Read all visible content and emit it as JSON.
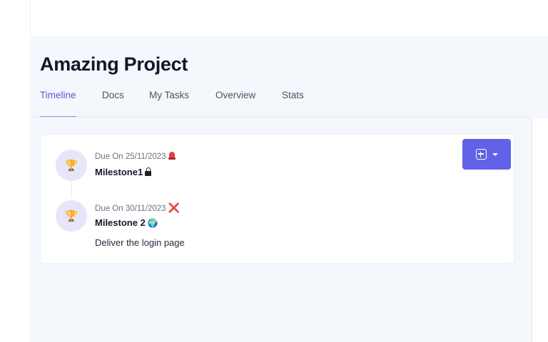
{
  "project": {
    "title": "Amazing Project"
  },
  "tabs": [
    {
      "label": "Timeline",
      "active": true
    },
    {
      "label": "Docs",
      "active": false
    },
    {
      "label": "My Tasks",
      "active": false
    },
    {
      "label": "Overview",
      "active": false
    },
    {
      "label": "Stats",
      "active": false
    }
  ],
  "milestones": [
    {
      "due": "Due On 25/11/2023",
      "due_icon": "alarm-light-icon",
      "title": "Milestone1",
      "title_icon": "lock-icon",
      "description": ""
    },
    {
      "due": "Due On 30/11/2023",
      "due_icon": "red-x-icon",
      "due_icon_glyph": "❌",
      "title": "Milestone 2",
      "title_icon": "globe-icon",
      "title_icon_glyph": "🌍",
      "description": "Deliver the login page"
    }
  ],
  "avatar_glyph": "🏆",
  "add_button": {
    "icon": "plus-square-icon",
    "dropdown_icon": "caret-down-icon"
  },
  "colors": {
    "accent": "#6262e9",
    "active_tab": "#5b5bd6",
    "avatar_bg": "#e6e6f8",
    "page_bg": "#f4f7fb"
  }
}
